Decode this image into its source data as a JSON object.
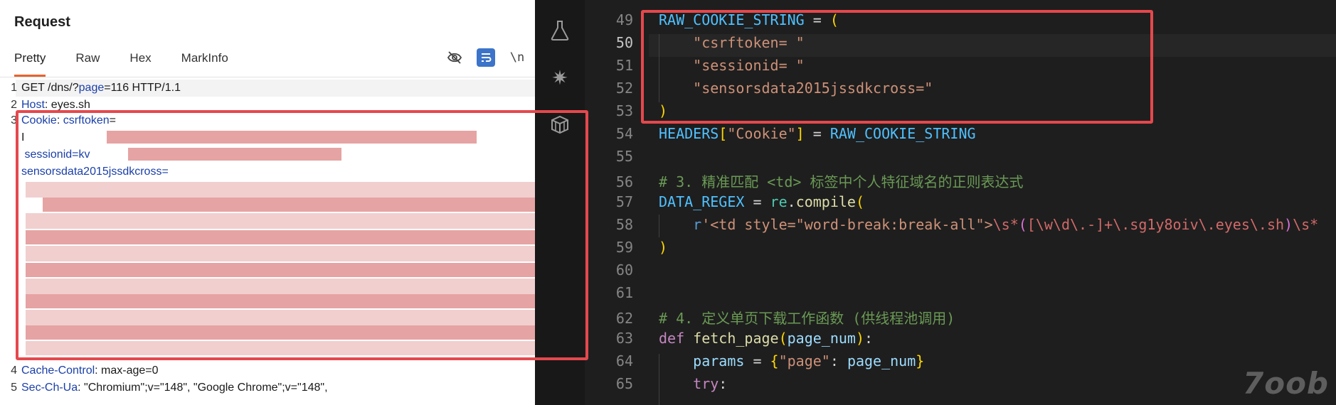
{
  "request_panel": {
    "title": "Request",
    "tabs": [
      {
        "label": "Pretty",
        "active": true
      },
      {
        "label": "Raw",
        "active": false
      },
      {
        "label": "Hex",
        "active": false
      },
      {
        "label": "MarkInfo",
        "active": false
      }
    ],
    "toolbar": {
      "hide_icon": "eye-slash-icon",
      "wrap_icon": "word-wrap-icon",
      "newline_label": "\\n",
      "menu_icon": "menu-icon"
    },
    "lines": [
      {
        "num": "1",
        "method": "GET",
        "path_a": " /dns/?",
        "param": "page",
        "path_b": "=116 HTTP/1.1"
      },
      {
        "num": "2",
        "name": "Host",
        "value": " eyes.sh"
      },
      {
        "num": "3",
        "name": "Cookie",
        "value": " ",
        "key": "csrftoken",
        "tail": "="
      },
      {
        "num": "",
        "text": "I"
      },
      {
        "num": "",
        "text": " sessionid=kv",
        "tail": ";"
      },
      {
        "num": "",
        "text": "sensorsdata2015jssdkcross="
      },
      {
        "num": "4",
        "name": "Cache-Control",
        "value": " max-age=0"
      },
      {
        "num": "5",
        "name": "Sec-Ch-Ua",
        "value": " \"Chromium\";v=\"148\", \"Google Chrome\";v=\"148\","
      }
    ]
  },
  "activity_bar": {
    "icons": [
      "flask-icon",
      "sparkle-icon",
      "package-icon"
    ]
  },
  "editor": {
    "current_line": "50",
    "lines": [
      {
        "num": "49",
        "tokens": [
          [
            "v",
            "RAW_COOKIE_STRING"
          ],
          [
            "w",
            " = "
          ],
          [
            "p1",
            "("
          ]
        ]
      },
      {
        "num": "50",
        "tokens": [
          [
            "w",
            "    "
          ],
          [
            "s",
            "\"csrftoken="
          ],
          [
            "s",
            " \""
          ]
        ]
      },
      {
        "num": "51",
        "tokens": [
          [
            "w",
            "    "
          ],
          [
            "s",
            "\"sessionid= \""
          ]
        ]
      },
      {
        "num": "52",
        "tokens": [
          [
            "w",
            "    "
          ],
          [
            "s",
            "\"sensorsdata2015jssdkcross=\""
          ]
        ]
      },
      {
        "num": "53",
        "tokens": [
          [
            "p1",
            ")"
          ]
        ]
      },
      {
        "num": "54",
        "tokens": [
          [
            "v",
            "HEADERS"
          ],
          [
            "p1",
            "["
          ],
          [
            "s",
            "\"Cookie\""
          ],
          [
            "p1",
            "]"
          ],
          [
            "w",
            " = "
          ],
          [
            "v",
            "RAW_COOKIE_STRING"
          ]
        ]
      },
      {
        "num": "55",
        "tokens": []
      },
      {
        "num": "56",
        "tokens": [
          [
            "cm",
            "# 3. 精准匹配 <td> 标签中个人特征域名的正则表达式"
          ]
        ]
      },
      {
        "num": "57",
        "tokens": [
          [
            "v",
            "DATA_REGEX"
          ],
          [
            "w",
            " = "
          ],
          [
            "mod",
            "re"
          ],
          [
            "w",
            "."
          ],
          [
            "fn",
            "compile"
          ],
          [
            "p1",
            "("
          ]
        ]
      },
      {
        "num": "58",
        "tokens": [
          [
            "w",
            "    "
          ],
          [
            "k",
            "r"
          ],
          [
            "s",
            "'<td style=\"word-break:break-all\">"
          ],
          [
            "re",
            "\\s*"
          ],
          [
            "p2",
            "("
          ],
          [
            "re",
            "[\\w\\d\\.-]+"
          ],
          [
            "re",
            "\\.sg1y8oiv\\.eyes\\.sh"
          ],
          [
            "p2",
            ")"
          ],
          [
            "re",
            "\\s*"
          ]
        ]
      },
      {
        "num": "59",
        "tokens": [
          [
            "p1",
            ")"
          ]
        ]
      },
      {
        "num": "60",
        "tokens": []
      },
      {
        "num": "61",
        "tokens": []
      },
      {
        "num": "62",
        "tokens": [
          [
            "cm",
            "# 4. 定义单页下载工作函数 (供线程池调用)"
          ]
        ]
      },
      {
        "num": "63",
        "tokens": [
          [
            "kd",
            "def"
          ],
          [
            "w",
            " "
          ],
          [
            "fn",
            "fetch_page"
          ],
          [
            "p1",
            "("
          ],
          [
            "vb",
            "page_num"
          ],
          [
            "p1",
            ")"
          ],
          [
            "w",
            ":"
          ]
        ]
      },
      {
        "num": "64",
        "tokens": [
          [
            "w",
            "    "
          ],
          [
            "vb",
            "params"
          ],
          [
            "w",
            " = "
          ],
          [
            "p1",
            "{"
          ],
          [
            "s",
            "\"page\""
          ],
          [
            "w",
            ": "
          ],
          [
            "vb",
            "page_num"
          ],
          [
            "p1",
            "}"
          ]
        ]
      },
      {
        "num": "65",
        "tokens": [
          [
            "w",
            "    "
          ],
          [
            "kd",
            "try"
          ],
          [
            "w",
            ":"
          ]
        ]
      }
    ]
  },
  "watermark": "7oob"
}
